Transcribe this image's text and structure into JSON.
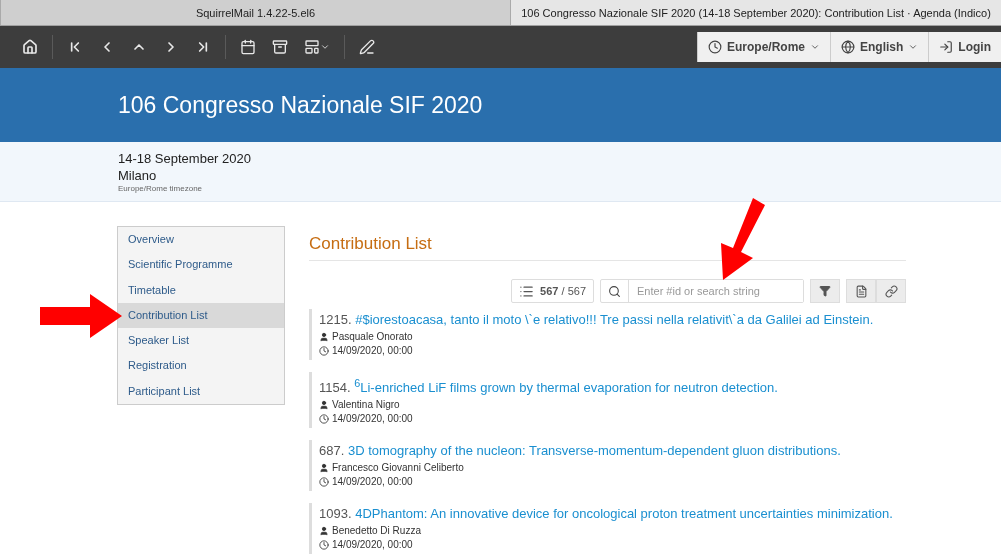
{
  "browser_tabs": [
    {
      "label": "SquirrelMail 1.4.22-5.el6",
      "selected": false
    },
    {
      "label": "106 Congresso Nazionale SIF 2020 (14-18 September 2020): Contribution List · Agenda (Indico)",
      "selected": true
    }
  ],
  "toolbar": {
    "timezone": "Europe/Rome",
    "language": "English",
    "login": "Login"
  },
  "header": {
    "title": "106 Congresso Nazionale SIF 2020",
    "dates": "14-18 September 2020",
    "venue": "Milano",
    "timezone_note": "Europe/Rome timezone"
  },
  "sidebar": {
    "items": [
      {
        "label": "Overview",
        "selected": false
      },
      {
        "label": "Scientific Programme",
        "selected": false
      },
      {
        "label": "Timetable",
        "selected": false
      },
      {
        "label": "Contribution List",
        "selected": true
      },
      {
        "label": "Speaker List",
        "selected": false
      },
      {
        "label": "Registration",
        "selected": false
      },
      {
        "label": "Participant List",
        "selected": false
      }
    ]
  },
  "content": {
    "title": "Contribution List",
    "count": "567",
    "total": "/ 567",
    "search": {
      "placeholder": "Enter #id or search string"
    },
    "contributions": [
      {
        "id": "1215.",
        "title": "#$iorestoacasa, tanto il moto \\`e relativo!!! Tre passi nella relativit\\`a da Galilei ad Einstein.",
        "speaker": "Pasquale Onorato",
        "time": "14/09/2020, 00:00"
      },
      {
        "id": "1154.",
        "title": "$^{6}$Li-enriched LiF films grown by thermal evaporation for neutron detection.",
        "speaker": "Valentina Nigro",
        "time": "14/09/2020, 00:00"
      },
      {
        "id": "687.",
        "title": "3D tomography of the nucleon: Transverse-momentum-dependent gluon distributions.",
        "speaker": "Francesco Giovanni Celiberto",
        "time": "14/09/2020, 00:00"
      },
      {
        "id": "1093.",
        "title": "4DPhantom: An innovative device for oncological proton treatment uncertainties minimization.",
        "speaker": "Benedetto Di Ruzza",
        "time": "14/09/2020, 00:00"
      }
    ]
  }
}
